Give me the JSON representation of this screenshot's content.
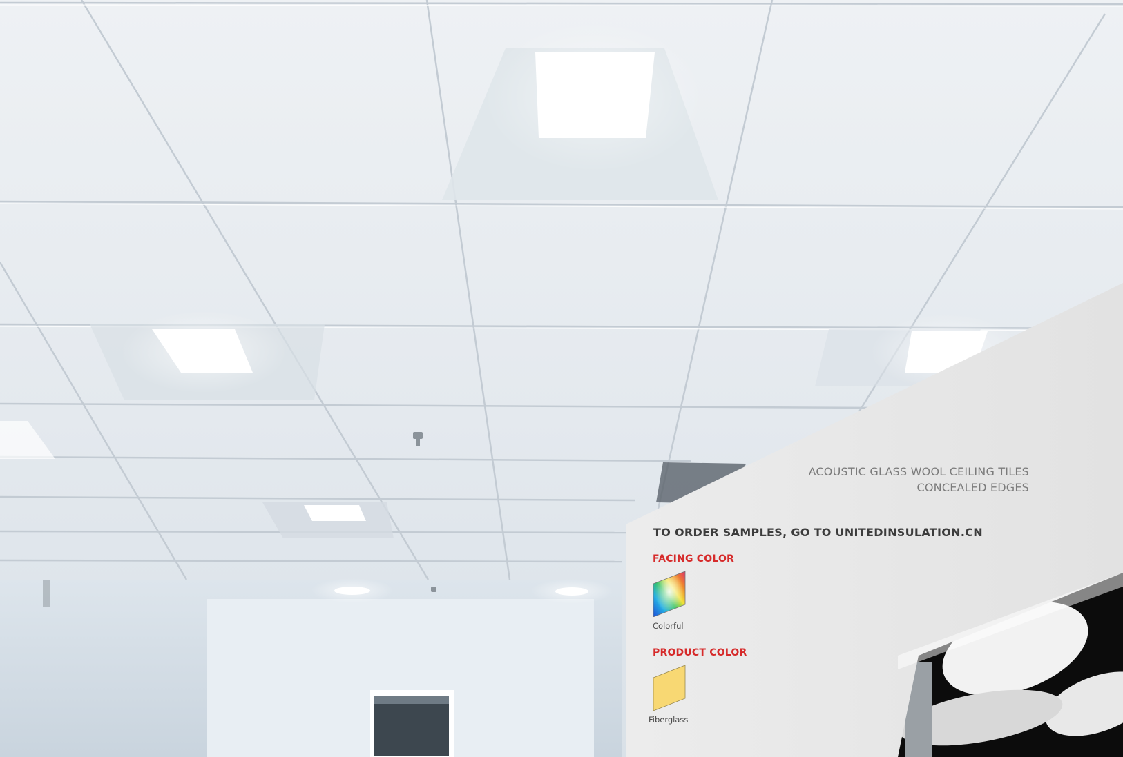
{
  "brochure": {
    "subtitle_line1": "ACOUSTIC GLASS WOOL CEILING TILES",
    "subtitle_line2": "CONCEALED EDGES",
    "order_text": "TO ORDER SAMPLES, GO TO UNITEDINSULATION.CN",
    "facing_color": {
      "label": "FACING COLOR",
      "swatch_name": "Colorful"
    },
    "product_color": {
      "label": "PRODUCT COLOR",
      "swatch_name": "Fiberglass",
      "swatch_color": "#f8d873"
    },
    "accent_color": "#d62b2b"
  },
  "photo": {
    "subject": "ceiling-tile-grid-with-recessed-lights"
  }
}
